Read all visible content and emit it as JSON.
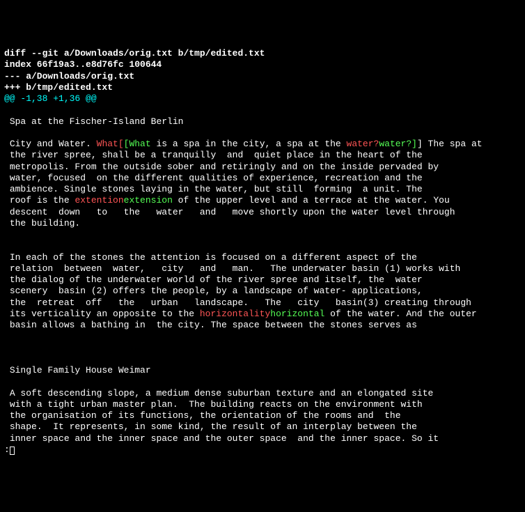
{
  "header": {
    "diff_line": "diff --git a/Downloads/orig.txt b/tmp/edited.txt",
    "index_line": "index 66f19a3..e8d76fc 100644",
    "minus_file": "--- a/Downloads/orig.txt",
    "plus_file": "+++ b/tmp/edited.txt"
  },
  "hunk": {
    "prefix": "@@ ",
    "range": "-1,38 +1,36",
    "suffix": " @@"
  },
  "body": {
    "blank1": " ",
    "title1": " Spa at the Fischer-Island Berlin",
    "blank2": " ",
    "p1_a": " City and Water. ",
    "p1_del1": "What[",
    "p1_add1": "[What",
    "p1_b": " is a spa in the city, a spa at the ",
    "p1_del2": "water?",
    "p1_add2": "water?]",
    "p1_c": "] The spa at",
    "p1_l2": " the river spree, shall be a tranquilly  and  quiet place in the heart of the",
    "p1_l3": " metropolis. From the outside sober and retiringly and on the inside pervaded by",
    "p1_l4": " water, focused  on the different qualities of experience, recreation and the",
    "p1_l5": " ambience. Single stones laying in the water, but still  forming  a unit. The",
    "p1_l6a": " roof is the ",
    "p1_del3": "extention",
    "p1_add3": "extension",
    "p1_l6b": " of the upper level and a terrace at the water. You",
    "p1_l7": " descent  down   to   the   water   and   move shortly upon the water level through",
    "p1_l8": " the building.",
    "blank3": " ",
    "blank4": " ",
    "p2_l1": " In each of the stones the attention is focused on a different aspect of the",
    "p2_l2": " relation  between  water,   city   and   man.   The underwater basin (1) works with",
    "p2_l3": " the dialog of the underwater world of the river spree and itself, the  water",
    "p2_l4": " scenery  basin (2) offers the people, by a landscape of water- applications,",
    "p2_l5": " the  retreat  off   the   urban   landscape.   The   city   basin(3) creating through",
    "p2_l6a": " its verticality an opposite to the ",
    "p2_del4": "horizontality",
    "p2_add4": "horizontal",
    "p2_l6b": " of the water. And the outer",
    "p2_l7": " basin allows a bathing in  the city. The space between the stones serves as",
    "blank5": " ",
    "blank6": " ",
    "blank7": " ",
    "title2": " Single Family House Weimar",
    "blank8": " ",
    "p3_l1": " A soft descending slope, a medium dense suburban texture and an elongated site",
    "p3_l2": " with a tight urban master plan.  The building reacts on the environment with",
    "p3_l3": " the organisation of its functions, the orientation of the rooms and  the",
    "p3_l4": " shape.  It represents, in some kind, the result of an interplay between the",
    "p3_l5": " inner space and the inner space and the outer space  and the inner space. So it"
  },
  "prompt": ":"
}
